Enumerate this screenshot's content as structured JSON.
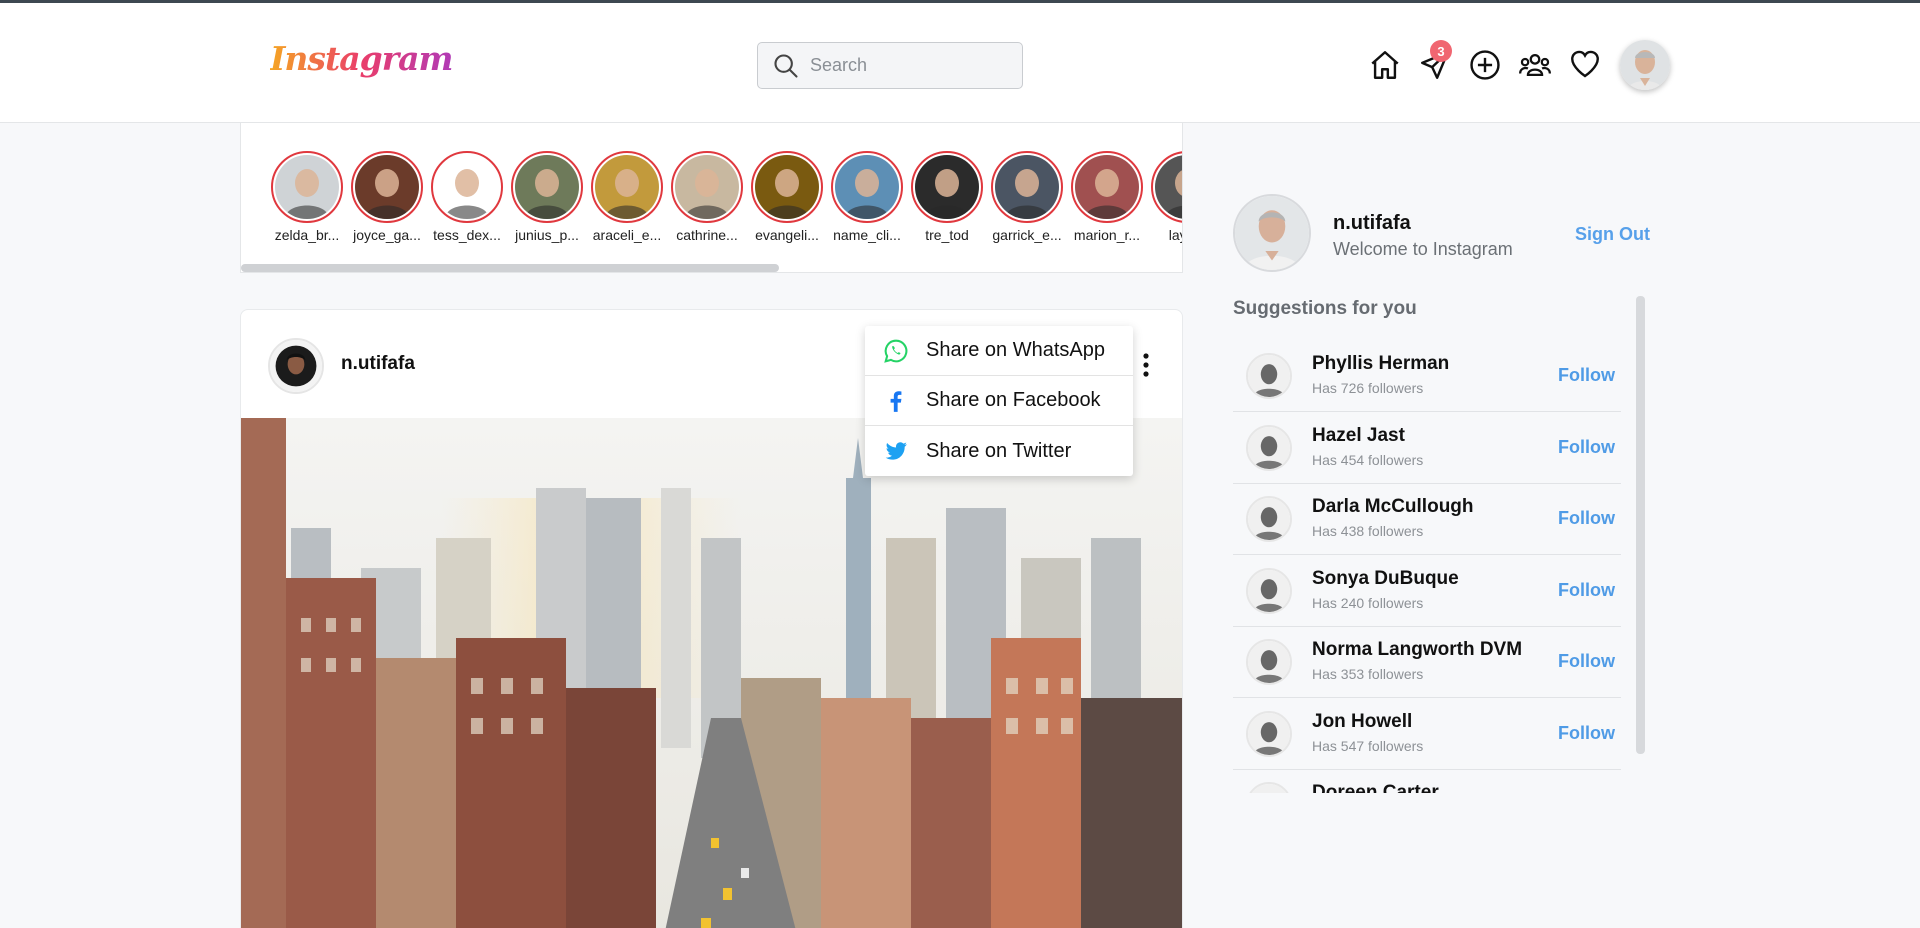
{
  "app": {
    "logo_text": "Instagram"
  },
  "search": {
    "placeholder": "Search",
    "value": ""
  },
  "nav": {
    "icons": [
      "home-icon",
      "paper-plane-icon",
      "plus-circle-icon",
      "people-icon",
      "heart-icon"
    ],
    "messages_badge": "3"
  },
  "stories": [
    {
      "name": "zelda_br..."
    },
    {
      "name": "joyce_ga..."
    },
    {
      "name": "tess_dex..."
    },
    {
      "name": "junius_p..."
    },
    {
      "name": "araceli_e..."
    },
    {
      "name": "cathrine..."
    },
    {
      "name": "evangeli..."
    },
    {
      "name": "name_cli..."
    },
    {
      "name": "tre_tod"
    },
    {
      "name": "garrick_e..."
    },
    {
      "name": "marion_r..."
    },
    {
      "name": "layla_"
    }
  ],
  "post": {
    "username": "n.utifafa"
  },
  "share_menu": {
    "items": [
      {
        "label": "Share on WhatsApp",
        "icon": "whatsapp-icon",
        "color": "#25d366"
      },
      {
        "label": "Share on Facebook",
        "icon": "facebook-icon",
        "color": "#1877f2"
      },
      {
        "label": "Share on Twitter",
        "icon": "twitter-icon",
        "color": "#1da1f2"
      }
    ]
  },
  "profile": {
    "username": "n.utifafa",
    "subtitle": "Welcome to Instagram",
    "sign_out_label": "Sign Out"
  },
  "suggestions": {
    "title": "Suggestions for you",
    "follow_label": "Follow",
    "items": [
      {
        "name": "Phyllis Herman",
        "followers": "Has 726 followers"
      },
      {
        "name": "Hazel Jast",
        "followers": "Has 454 followers"
      },
      {
        "name": "Darla McCullough",
        "followers": "Has 438 followers"
      },
      {
        "name": "Sonya DuBuque",
        "followers": "Has 240 followers"
      },
      {
        "name": "Norma Langworth DVM",
        "followers": "Has 353 followers"
      },
      {
        "name": "Jon Howell",
        "followers": "Has 547 followers"
      },
      {
        "name": "Doreen Carter",
        "followers": ""
      }
    ]
  },
  "colors": {
    "accent_blue": "#4f9be6",
    "story_ring": "#e0383e",
    "badge": "#f06671"
  }
}
